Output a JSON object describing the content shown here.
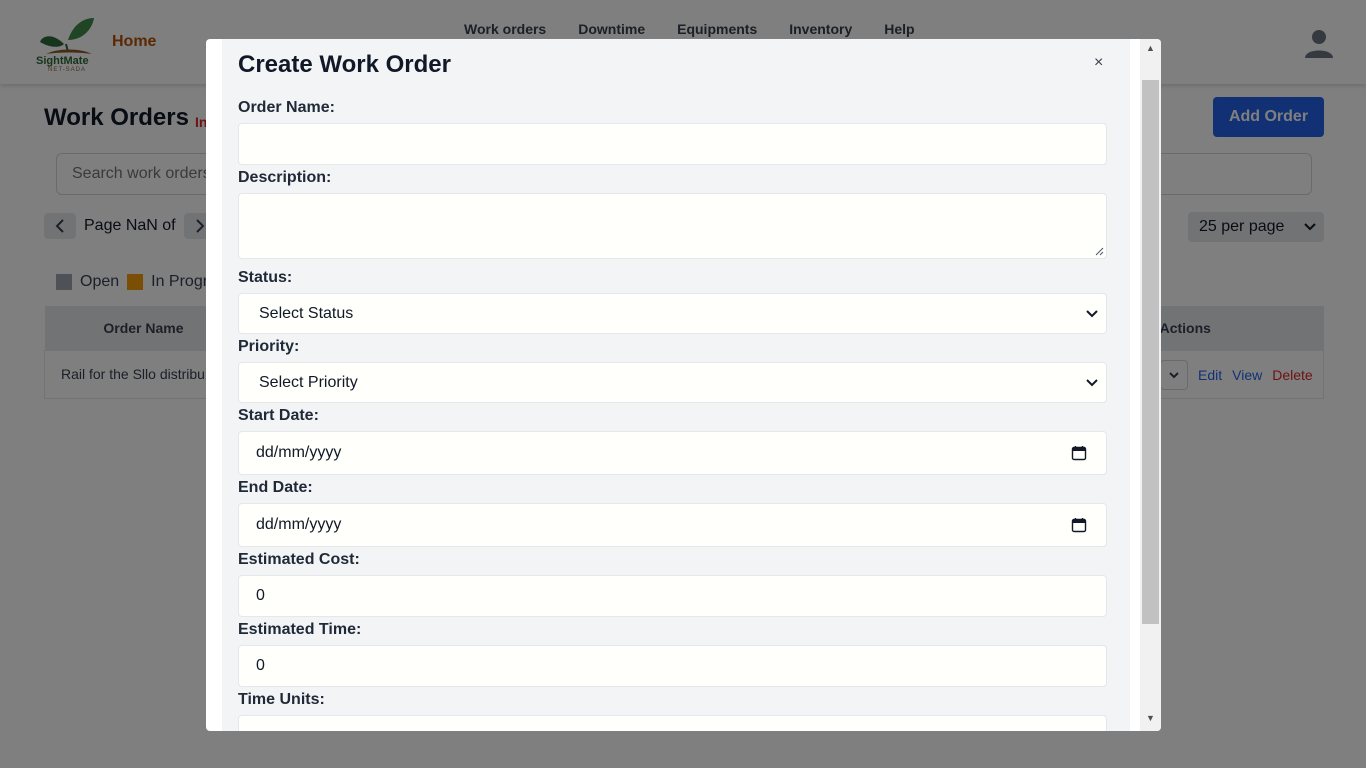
{
  "header": {
    "home_label": "Home",
    "logo_text": "SightMate",
    "logo_subtext": "NET-SADA",
    "nav": [
      "Work orders",
      "Downtime",
      "Equipments",
      "Inventory",
      "Help"
    ]
  },
  "page": {
    "title": "Work Orders",
    "title_badge": "In",
    "add_button": "Add Order",
    "search_placeholder": "Search work orders",
    "pager": {
      "label": "Page NaN of"
    },
    "per_page": "25 per page",
    "legend": [
      {
        "label": "Open",
        "color": "#9ca3af"
      },
      {
        "label": "In Progr",
        "color": "#f59e0b"
      }
    ],
    "table": {
      "headers": {
        "order_name": "Order Name",
        "actions": "Actions"
      },
      "row": {
        "order_name": "Rail for the Sllo distribu",
        "edit": "Edit",
        "view": "View",
        "delete": "Delete"
      }
    }
  },
  "modal": {
    "title": "Create Work Order",
    "close": "×",
    "fields": {
      "order_name": {
        "label": "Order Name:",
        "value": ""
      },
      "description": {
        "label": "Description:",
        "value": ""
      },
      "status": {
        "label": "Status:",
        "value": "Select Status"
      },
      "priority": {
        "label": "Priority:",
        "value": "Select Priority"
      },
      "start_date": {
        "label": "Start Date:",
        "value": "dd/mm/yyyy"
      },
      "end_date": {
        "label": "End Date:",
        "value": "dd/mm/yyyy"
      },
      "estimated_cost": {
        "label": "Estimated Cost:",
        "value": "0"
      },
      "estimated_time": {
        "label": "Estimated Time:",
        "value": "0"
      },
      "time_units": {
        "label": "Time Units:",
        "value": ""
      }
    }
  },
  "colors": {
    "accent": "#2563eb",
    "home": "#b45309",
    "danger": "#dc2626"
  }
}
